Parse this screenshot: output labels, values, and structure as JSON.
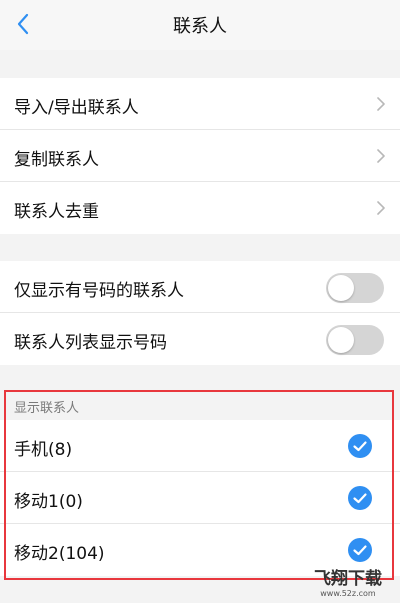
{
  "header": {
    "title": "联系人",
    "back_icon": "back-chevron-icon"
  },
  "group1": {
    "items": [
      {
        "label": "导入/导出联系人",
        "icon": "chevron-right-icon"
      },
      {
        "label": "复制联系人",
        "icon": "chevron-right-icon"
      },
      {
        "label": "联系人去重",
        "icon": "chevron-right-icon"
      }
    ]
  },
  "group2": {
    "items": [
      {
        "label": "仅显示有号码的联系人",
        "toggle_on": false
      },
      {
        "label": "联系人列表显示号码",
        "toggle_on": false
      }
    ]
  },
  "display_contacts": {
    "header": "显示联系人",
    "items": [
      {
        "label": "手机(8)",
        "checked": true
      },
      {
        "label": "移动1(0)",
        "checked": true
      },
      {
        "label": "移动2(104)",
        "checked": true
      }
    ]
  },
  "colors": {
    "accent_check": "#2f8ff2",
    "highlight_border": "#e8373d",
    "back_icon": "#2f8ff2",
    "toggle_off": "#d5d5d5"
  },
  "watermark": {
    "text": "飞翔下载",
    "url_text": "www.52z.com"
  }
}
